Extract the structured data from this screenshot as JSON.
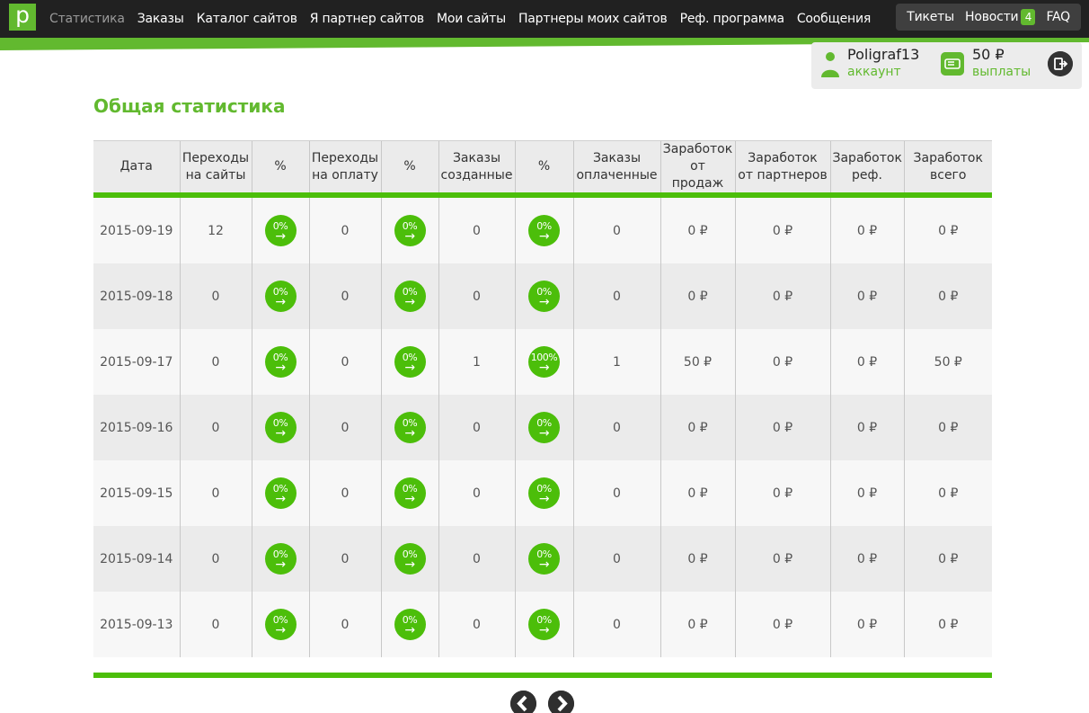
{
  "brand": {
    "logo_letter": "p",
    "color": "#62b92f"
  },
  "nav": {
    "items": [
      {
        "label": "Статистика",
        "active": true
      },
      {
        "label": "Заказы"
      },
      {
        "label": "Каталог сайтов"
      },
      {
        "label": "Я партнер сайтов"
      },
      {
        "label": "Мои сайты"
      },
      {
        "label": "Партнеры моих сайтов"
      },
      {
        "label": "Реф. программа"
      },
      {
        "label": "Сообщения"
      }
    ],
    "right": {
      "tickets": "Тикеты",
      "news": "Новости",
      "news_badge": "4",
      "faq": "FAQ"
    }
  },
  "account": {
    "name": "Poligraf13",
    "name_sub": "аккаунт",
    "payout": "50 ₽",
    "payout_sub": "выплаты"
  },
  "page": {
    "title": "Общая статистика"
  },
  "table": {
    "headers": [
      "Дата",
      "Переходы\nна сайты",
      "%",
      "Переходы\nна оплату",
      "%",
      "Заказы\nсозданные",
      "%",
      "Заказы\nоплаченные",
      "Заработок\nот продаж",
      "Заработок\nот партнеров",
      "Заработок\nреф.",
      "Заработок\nвсего"
    ],
    "rows": [
      [
        "2015-09-19",
        "12",
        "0%",
        "0",
        "0%",
        "0",
        "0%",
        "0",
        "0 ₽",
        "0 ₽",
        "0 ₽",
        "0 ₽"
      ],
      [
        "2015-09-18",
        "0",
        "0%",
        "0",
        "0%",
        "0",
        "0%",
        "0",
        "0 ₽",
        "0 ₽",
        "0 ₽",
        "0 ₽"
      ],
      [
        "2015-09-17",
        "0",
        "0%",
        "0",
        "0%",
        "1",
        "100%",
        "1",
        "50 ₽",
        "0 ₽",
        "0 ₽",
        "50 ₽"
      ],
      [
        "2015-09-16",
        "0",
        "0%",
        "0",
        "0%",
        "0",
        "0%",
        "0",
        "0 ₽",
        "0 ₽",
        "0 ₽",
        "0 ₽"
      ],
      [
        "2015-09-15",
        "0",
        "0%",
        "0",
        "0%",
        "0",
        "0%",
        "0",
        "0 ₽",
        "0 ₽",
        "0 ₽",
        "0 ₽"
      ],
      [
        "2015-09-14",
        "0",
        "0%",
        "0",
        "0%",
        "0",
        "0%",
        "0",
        "0 ₽",
        "0 ₽",
        "0 ₽",
        "0 ₽"
      ],
      [
        "2015-09-13",
        "0",
        "0%",
        "0",
        "0%",
        "0",
        "0%",
        "0",
        "0 ₽",
        "0 ₽",
        "0 ₽",
        "0 ₽"
      ]
    ],
    "pct_arrow": "→"
  },
  "pagination": {
    "prev_icon": "chevron-left-icon",
    "next_icon": "chevron-right-icon"
  },
  "colors": {
    "accent": "#4cbe0a",
    "topbar": "#212121"
  }
}
